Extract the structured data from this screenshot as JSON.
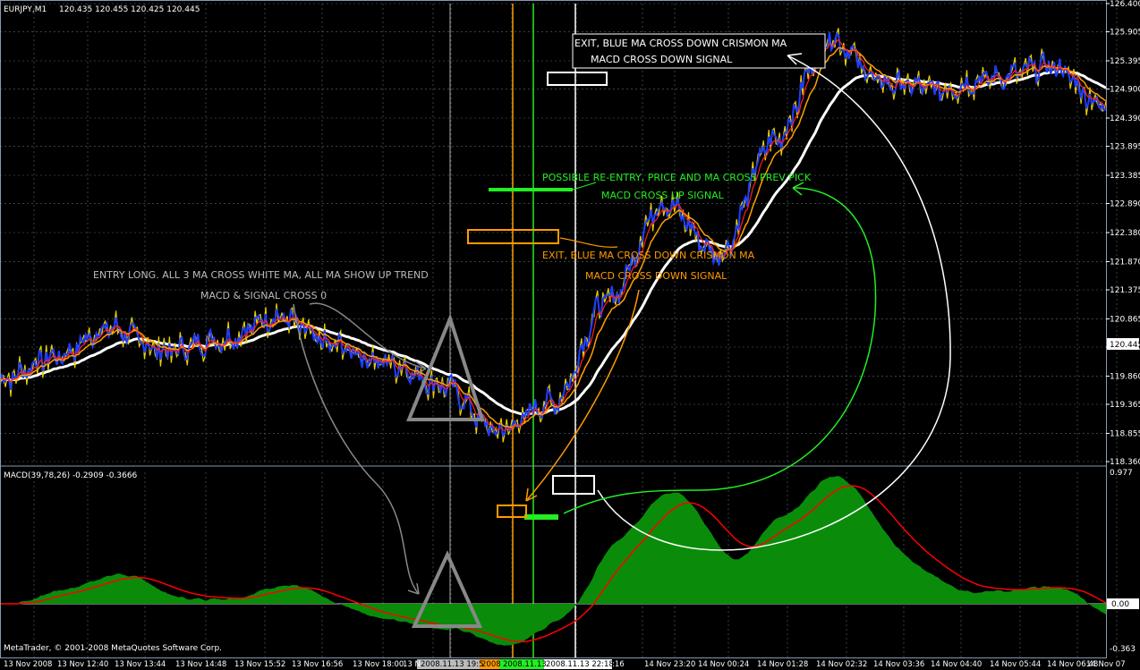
{
  "header": {
    "symbol": "EURJPY,M1",
    "ohlc": "120.435 120.455 120.425 120.445"
  },
  "price_axis": {
    "ticks": [
      "126.400",
      "125.905",
      "125.395",
      "124.900",
      "124.390",
      "123.895",
      "123.385",
      "122.890",
      "122.380",
      "121.870",
      "121.375",
      "120.865",
      "120.370",
      "119.860",
      "119.365",
      "118.855",
      "118.360"
    ],
    "current": "120.445"
  },
  "macd_panel": {
    "label": "MACD(39,78,26) -0.2909 -0.3666",
    "ticks": [
      "0.977",
      "0.00",
      "-0.363"
    ]
  },
  "time_axis": {
    "ticks": [
      "13 Nov 2008",
      "13 Nov 12:40",
      "13 Nov 13:44",
      "13 Nov 14:48",
      "13 Nov 15:52",
      "13 Nov 16:56",
      "13 Nov 18:00",
      "13 N",
      "2008.11.13 19:5",
      "2008",
      "2008.11.13",
      "2008.11.13 22:18",
      ":16",
      "14 Nov 23:20",
      "14 Nov 00:24",
      "14 Nov 01:28",
      "14 Nov 02:32",
      "14 Nov 03:36",
      "14 Nov 04:40",
      "14 Nov 05:44",
      "14 Nov 06:48",
      "14 Nov 07"
    ]
  },
  "copyright": "MetaTrader, © 2001-2008 MetaQuotes Software Corp.",
  "annotations": {
    "exit1_line1": "EXIT, BLUE MA CROSS DOWN CRISMON MA",
    "exit1_line2": "MACD CROSS DOWN SIGNAL",
    "reentry_line1": "POSSIBLE RE-ENTRY, PRICE AND MA CROSS PREV PICK",
    "reentry_line2": "MACD CROSS UP SIGNAL",
    "exit2_line1": "EXIT, BLUE MA CROSS DOWN CRISMON MA",
    "exit2_line2": "MACD CROSS DOWN SIGNAL",
    "entry_line1": "ENTRY LONG. ALL 3 MA CROSS WHITE MA, ALL MA SHOW UP TREND",
    "entry_line2": "MACD & SIGNAL CROSS 0"
  },
  "colors": {
    "price": "#1f3dff",
    "price_wick": "#e8d000",
    "ma_red": "#ff2020",
    "ma_orange": "#ffa000",
    "ma_white": "#ffffff",
    "grid": "#5a6a7a",
    "macd_hist": "#0a8c0a",
    "macd_signal": "#ff0000",
    "green": "#22ee22",
    "orange": "#ff9a00",
    "grey": "#888888"
  },
  "chart_data": {
    "type": "line",
    "title": "EURJPY,M1",
    "ylim": [
      118.36,
      126.4
    ],
    "x": [
      0,
      10,
      20,
      30,
      40,
      50,
      60,
      70,
      80,
      90,
      100,
      110,
      120,
      130,
      140,
      150,
      160,
      170,
      180,
      190,
      200
    ],
    "series": [
      {
        "values": [
          119.8,
          120.2,
          120.7,
          120.3,
          120.5,
          120.9,
          120.4,
          120.1,
          119.7,
          118.9,
          119.4,
          121.2,
          122.9,
          122.0,
          124.0,
          125.8,
          125.0,
          124.9,
          125.1,
          125.3,
          124.6
        ]
      }
    ],
    "macd_ylim": [
      -0.363,
      0.977
    ]
  }
}
